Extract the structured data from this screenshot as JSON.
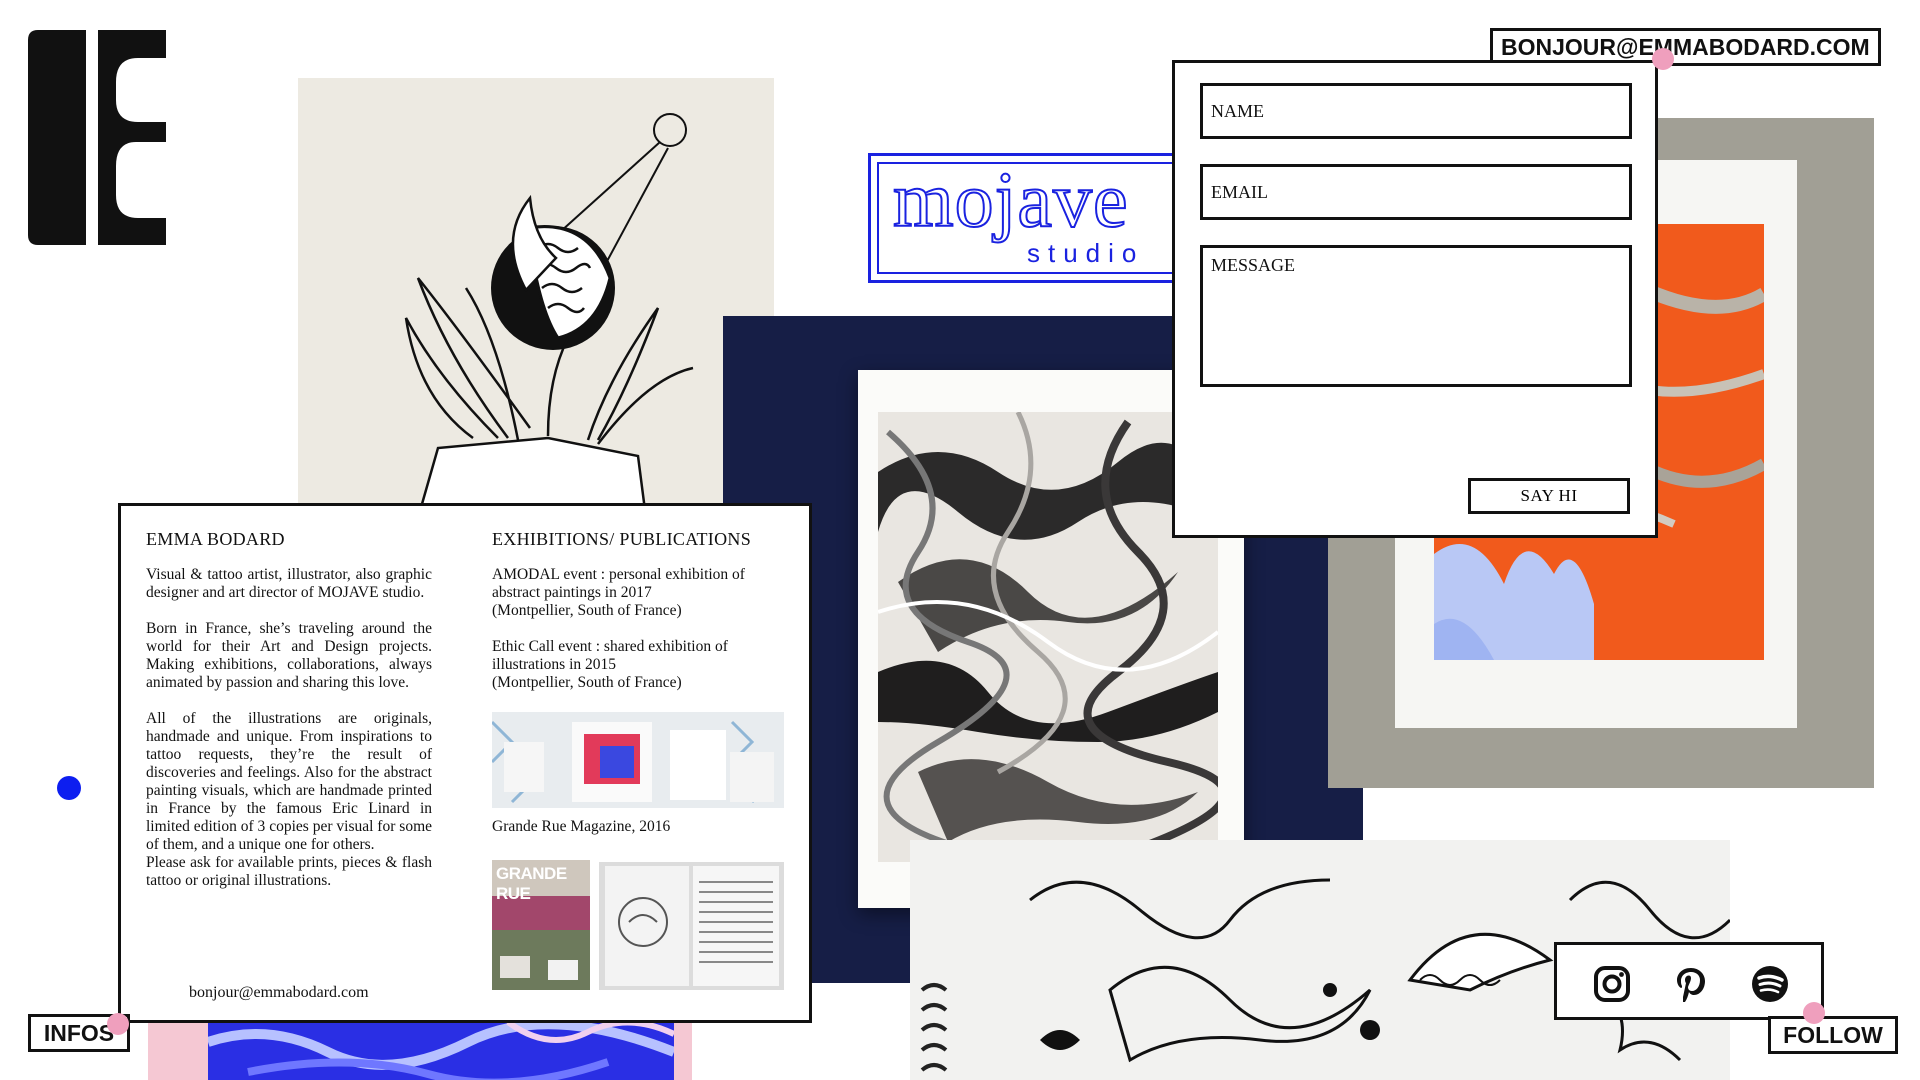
{
  "brand": {
    "logo_letter": "B"
  },
  "header": {
    "email": "BONJOUR@EMMABODARD.COM"
  },
  "mojave": {
    "word": "mojave",
    "sub": "studio"
  },
  "contact_form": {
    "name_placeholder": "NAME",
    "email_placeholder": "EMAIL",
    "message_placeholder": "MESSAGE",
    "submit_label": "SAY HI"
  },
  "info": {
    "title": "EMMA BODARD",
    "bio": [
      "Visual & tattoo artist, illustrator, also graphic designer and art director of MOJAVE studio.",
      "Born in France, she’s traveling around the world for their Art and Design projects. Making exhibitions, collaborations, always animated by passion and sharing this love.",
      "All of the illustrations are originals, handmade and unique. From inspirations to tattoo requests, they’re the result of discoveries and feelings. Also for the abstract painting visuals, which are handmade printed in France by the famous Eric Linard in limited edition of 3 copies per visual for some of them, and a unique one for others.\nPlease ask for available prints, pieces & flash tattoo or original illustrations."
    ],
    "email": "bonjour@emmabodard.com",
    "exhibitions_title": "EXHIBITIONS/ PUBLICATIONS",
    "exhibitions": [
      "AMODAL event : personal exhibition of abstract paintings in 2017\n(Montpellier, South of France)",
      "Ethic Call event : shared exhibition of illustrations in 2015\n(Montpellier, South of France)"
    ],
    "publication_caption": "Grande Rue Magazine, 2016",
    "magazine_cover_title": "GRANDE RUE"
  },
  "nav": {
    "infos_label": "INFOS",
    "follow_label": "FOLLOW"
  },
  "social": [
    "instagram-icon",
    "pinterest-icon",
    "spotify-icon"
  ],
  "colors": {
    "accent_blue": "#1a22e0",
    "dot_pink": "#ef9fbd",
    "navy": "#161e46",
    "orange": "#f15a1c"
  }
}
